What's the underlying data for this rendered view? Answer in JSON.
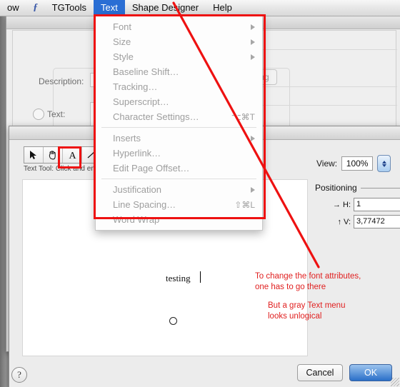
{
  "menubar": {
    "items": [
      {
        "label": "ow",
        "name": "menubar-item-window",
        "selected": false
      },
      {
        "label": "ƒ",
        "name": "menubar-item-app-icon",
        "selected": false
      },
      {
        "label": "TGTools",
        "name": "menubar-item-tgtools",
        "selected": false
      },
      {
        "label": "Text",
        "name": "menubar-item-text",
        "selected": true
      },
      {
        "label": "Shape Designer",
        "name": "menubar-item-shape-designer",
        "selected": false
      },
      {
        "label": "Help",
        "name": "menubar-item-help",
        "selected": false
      }
    ]
  },
  "text_menu": {
    "title": "Text",
    "groups": [
      [
        {
          "label": "Font",
          "submenu": true,
          "shortcut": ""
        },
        {
          "label": "Size",
          "submenu": true,
          "shortcut": ""
        },
        {
          "label": "Style",
          "submenu": true,
          "shortcut": ""
        },
        {
          "label": "Baseline Shift…",
          "submenu": false,
          "shortcut": ""
        },
        {
          "label": "Tracking…",
          "submenu": false,
          "shortcut": ""
        },
        {
          "label": "Superscript…",
          "submenu": false,
          "shortcut": ""
        },
        {
          "label": "Character Settings…",
          "submenu": false,
          "shortcut": "⌥⌘T"
        }
      ],
      [
        {
          "label": "Inserts",
          "submenu": true,
          "shortcut": ""
        },
        {
          "label": "Hyperlink…",
          "submenu": false,
          "shortcut": ""
        },
        {
          "label": "Edit Page Offset…",
          "submenu": false,
          "shortcut": ""
        }
      ],
      [
        {
          "label": "Justification",
          "submenu": true,
          "shortcut": ""
        },
        {
          "label": "Line Spacing…",
          "submenu": false,
          "shortcut": "⇧⌘L"
        },
        {
          "label": "Word Wrap",
          "submenu": false,
          "shortcut": ""
        }
      ]
    ]
  },
  "rear_dialog": {
    "description_label": "Description:",
    "description_value": "",
    "text_radio_label": "Text:",
    "text_value": "",
    "tab_label": "ning"
  },
  "front_dialog": {
    "tools": [
      {
        "name": "arrow-tool",
        "glyph": "arrow"
      },
      {
        "name": "hand-tool",
        "glyph": "hand"
      },
      {
        "name": "text-tool",
        "glyph": "A",
        "selected": true
      },
      {
        "name": "line-tool",
        "glyph": "line"
      }
    ],
    "tool_hint": "Text Tool: Click and en",
    "canvas": {
      "text": "testing",
      "marker": "○"
    },
    "view": {
      "label": "View:",
      "value": "100%"
    },
    "positioning": {
      "header": "Positioning",
      "rows": [
        {
          "axis": "→ H:",
          "value": "1"
        },
        {
          "axis": "↑ V:",
          "value": "3,77472"
        }
      ]
    },
    "buttons": {
      "help": "?",
      "cancel": "Cancel",
      "ok": "OK"
    }
  },
  "annotations": {
    "color": "#e02020",
    "note1": "To change the font attributes,\none has to go there",
    "note2": "But a gray Text menu\nlooks unlogical"
  }
}
